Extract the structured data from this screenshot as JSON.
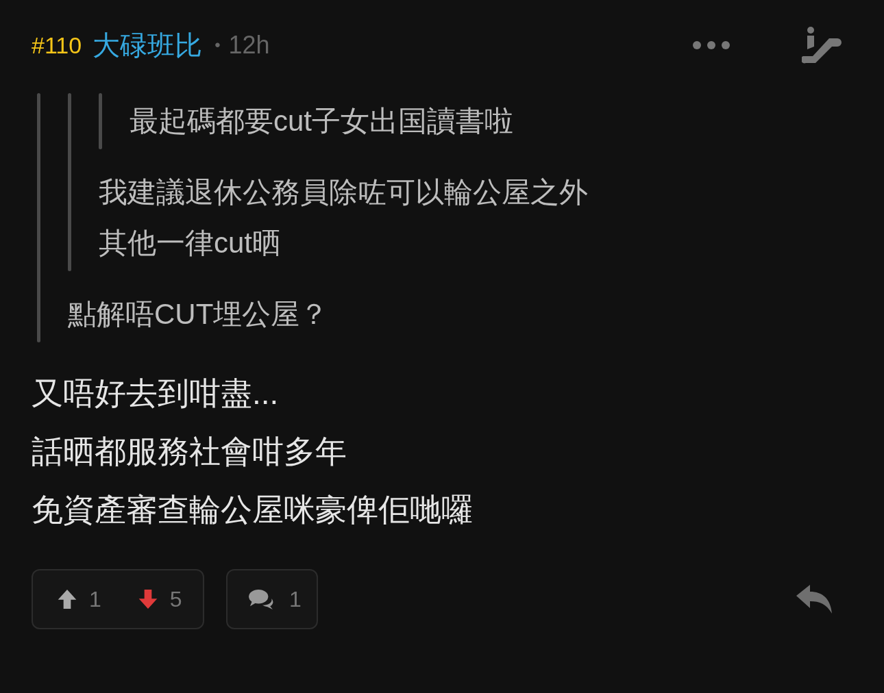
{
  "header": {
    "floor": "#110",
    "username": "大碌班比",
    "separator": "•",
    "time": "12h"
  },
  "quote": {
    "quote": {
      "quote": {
        "lines": [
          "最起碼都要cut子女出国讀書啦"
        ]
      },
      "lines": [
        "我建議退休公務員除咗可以輪公屋之外",
        "其他一律cut晒"
      ]
    },
    "lines": [
      "點解唔CUT埋公屋？"
    ]
  },
  "body": [
    "又唔好去到咁盡...",
    "話晒都服務社會咁多年",
    "免資產審查輪公屋咪豪俾佢哋囉"
  ],
  "votes": [
    {
      "kind": "up",
      "count": "1",
      "selected": false
    },
    {
      "kind": "down",
      "count": "5",
      "selected": true
    }
  ],
  "replies": {
    "count": "1"
  }
}
